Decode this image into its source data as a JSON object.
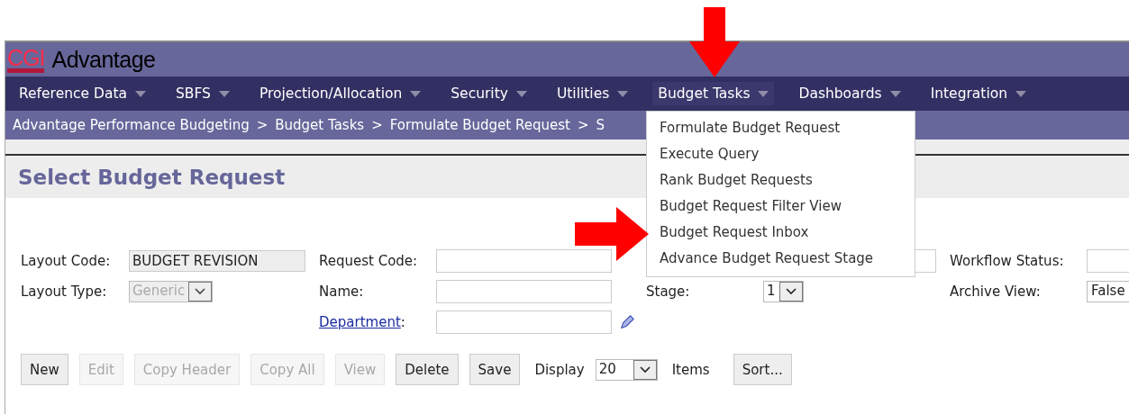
{
  "logo": {
    "brand": "CGI",
    "product": "Advantage"
  },
  "nav": [
    {
      "label": "Reference Data",
      "selected": false
    },
    {
      "label": "SBFS",
      "selected": false
    },
    {
      "label": "Projection/Allocation",
      "selected": false
    },
    {
      "label": "Security",
      "selected": false
    },
    {
      "label": "Utilities",
      "selected": false
    },
    {
      "label": "Budget Tasks",
      "selected": true
    },
    {
      "label": "Dashboards",
      "selected": false
    },
    {
      "label": "Integration",
      "selected": false
    }
  ],
  "breadcrumb": [
    "Advantage Performance Budgeting",
    ">",
    "Budget Tasks",
    ">",
    "Formulate Budget Request",
    ">",
    "S"
  ],
  "menu": [
    "Formulate Budget Request",
    "Execute Query",
    "Rank Budget Requests",
    "Budget Request Filter View",
    "Budget Request Inbox",
    "Advance Budget Request Stage"
  ],
  "page_title": "Select Budget Request",
  "form": {
    "layout_code": {
      "label": "Layout Code:",
      "value": "BUDGET REVISION"
    },
    "layout_type": {
      "label": "Layout Type:",
      "value": "Generic"
    },
    "request_code": {
      "label": "Request Code:"
    },
    "name": {
      "label": "Name:"
    },
    "department": {
      "label": "Department",
      "suffix": ":"
    },
    "stage": {
      "label": "Stage:",
      "value": "1"
    },
    "workflow_status": {
      "label": "Workflow Status:"
    },
    "archive_view": {
      "label": "Archive View:",
      "value": "False"
    }
  },
  "buttons": [
    {
      "label": "New",
      "disabled": false
    },
    {
      "label": "Edit",
      "disabled": true
    },
    {
      "label": "Copy Header",
      "disabled": true
    },
    {
      "label": "Copy All",
      "disabled": true
    },
    {
      "label": "View",
      "disabled": true
    },
    {
      "label": "Delete",
      "disabled": false
    },
    {
      "label": "Save",
      "disabled": false
    }
  ],
  "display": {
    "label": "Display",
    "value": "20",
    "suffix": "Items"
  },
  "sort_button": {
    "label": "Sort...",
    "disabled": false
  }
}
